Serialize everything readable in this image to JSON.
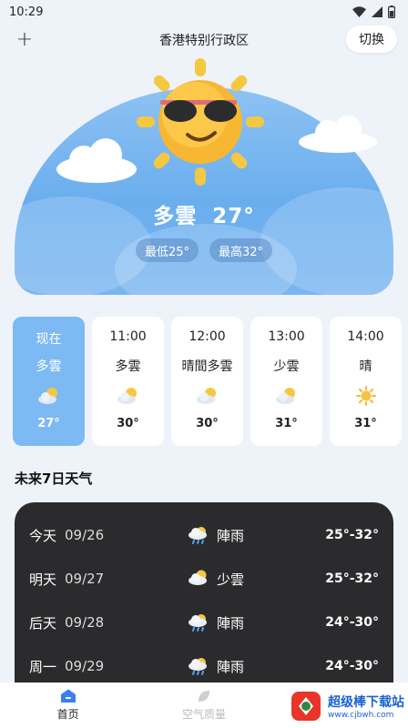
{
  "status_bar": {
    "time": "10:29"
  },
  "header": {
    "region": "香港特别行政区",
    "switch_label": "切换",
    "add_symbol": "+"
  },
  "hero": {
    "condition": "多雲",
    "temperature": "27°",
    "min_label": "最低25°",
    "max_label": "最高32°"
  },
  "hourly": [
    {
      "time": "现在",
      "condition": "多雲",
      "icon": "cloudy-sun-icon",
      "temp": "27°"
    },
    {
      "time": "11:00",
      "condition": "多雲",
      "icon": "cloudy-sun-icon",
      "temp": "30°"
    },
    {
      "time": "12:00",
      "condition": "晴間多雲",
      "icon": "cloudy-sun-icon",
      "temp": "30°"
    },
    {
      "time": "13:00",
      "condition": "少雲",
      "icon": "cloudy-sun-icon",
      "temp": "31°"
    },
    {
      "time": "14:00",
      "condition": "晴",
      "icon": "sun-icon",
      "temp": "31°"
    }
  ],
  "week": {
    "title": "未来7日天气",
    "days": [
      {
        "name": "今天",
        "date": "09/26",
        "icon": "rain-icon",
        "condition": "陣雨",
        "range": "25°-32°"
      },
      {
        "name": "明天",
        "date": "09/27",
        "icon": "cloudy-sun-icon",
        "condition": "少雲",
        "range": "25°-32°"
      },
      {
        "name": "后天",
        "date": "09/28",
        "icon": "rain-icon",
        "condition": "陣雨",
        "range": "24°-30°"
      },
      {
        "name": "周一",
        "date": "09/29",
        "icon": "rain-icon",
        "condition": "陣雨",
        "range": "24°-30°"
      }
    ]
  },
  "nav": {
    "home_label": "首页",
    "air_label": "空气质量"
  },
  "watermark": {
    "main": "超级棒下载站",
    "sub": "www.cjbwh.com"
  },
  "colors": {
    "accent": "#7db9f2",
    "panel": "#2b2b2d",
    "sky": "#6aaeee"
  }
}
